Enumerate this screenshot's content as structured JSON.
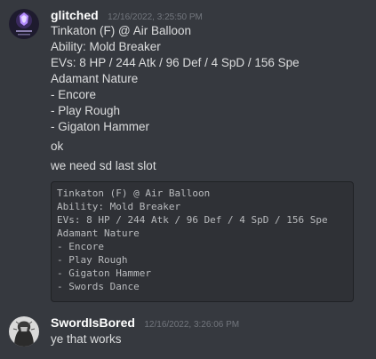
{
  "colors": {
    "background": "#36393f",
    "username": "#ffffff",
    "timestamp": "#72767d",
    "text": "#dcddde",
    "codeblock_bg": "#2f3136"
  },
  "messages": [
    {
      "author": "glitched",
      "timestamp": "12/16/2022, 3:25:50 PM",
      "avatar_icon": "purple-emblem-avatar",
      "lines": [
        "Tinkaton (F) @ Air Balloon",
        "Ability: Mold Breaker",
        "EVs: 8 HP / 244 Atk / 96 Def / 4 SpD / 156 Spe",
        "Adamant Nature",
        "- Encore",
        "- Play Rough",
        "- Gigaton Hammer"
      ],
      "followups": [
        "ok",
        "we need sd last slot"
      ],
      "code_lines": [
        "Tinkaton (F) @ Air Balloon",
        "Ability: Mold Breaker",
        "EVs: 8 HP / 244 Atk / 96 Def / 4 SpD / 156 Spe",
        "Adamant Nature",
        "- Encore",
        "- Play Rough",
        "- Gigaton Hammer",
        "- Swords Dance"
      ]
    },
    {
      "author": "SwordIsBored",
      "timestamp": "12/16/2022, 3:26:06 PM",
      "avatar_icon": "sketch-portrait-avatar",
      "lines": [
        "ye that works"
      ]
    }
  ]
}
